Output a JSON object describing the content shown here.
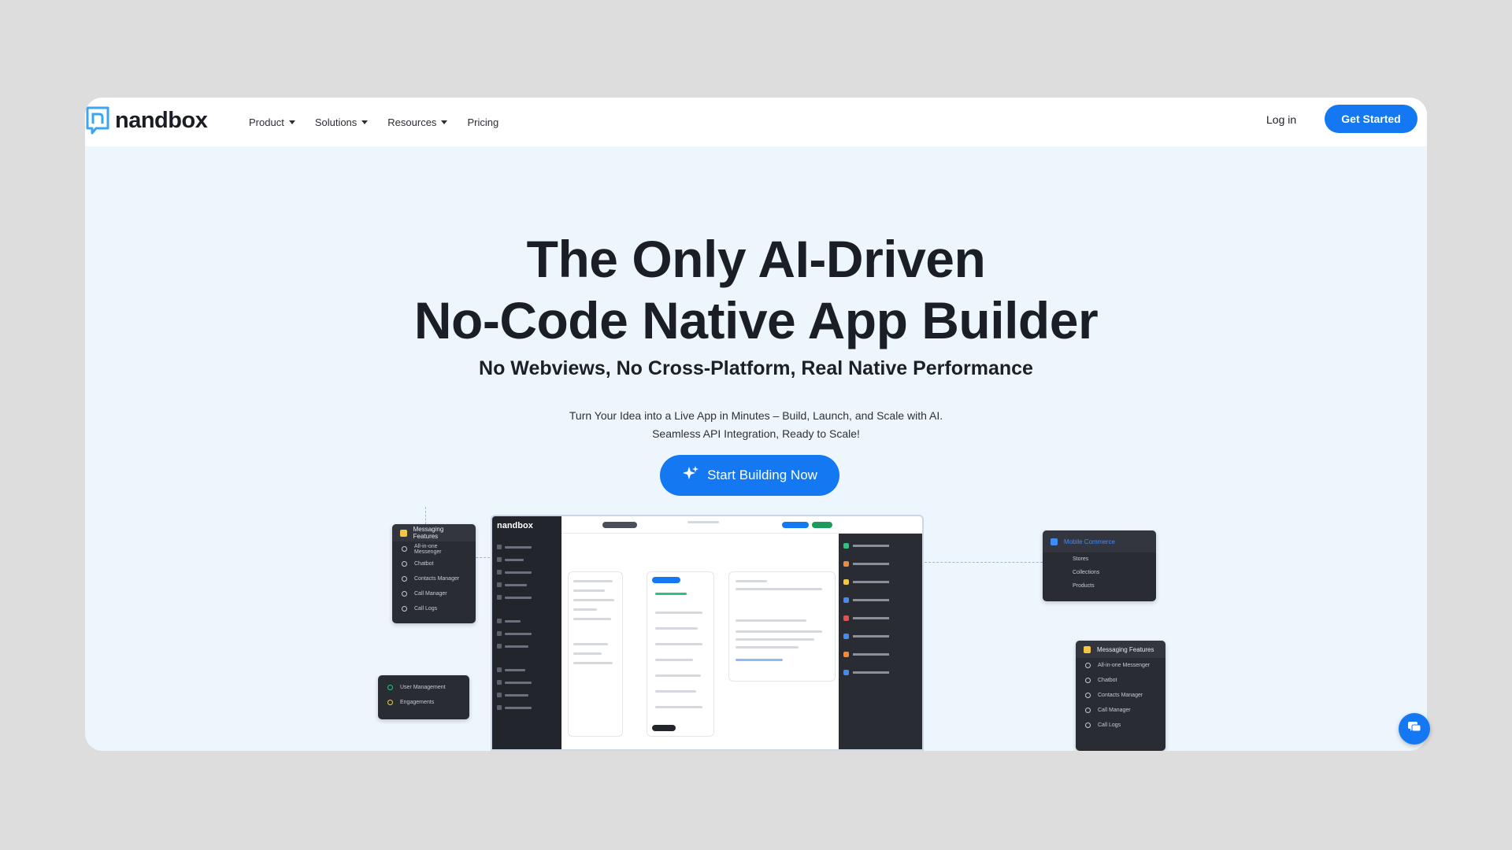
{
  "header": {
    "logo_text": "nandbox",
    "nav": [
      {
        "label": "Product",
        "has_dropdown": true
      },
      {
        "label": "Solutions",
        "has_dropdown": true
      },
      {
        "label": "Resources",
        "has_dropdown": true
      },
      {
        "label": "Pricing",
        "has_dropdown": false
      }
    ],
    "login_label": "Log in",
    "cta_label": "Get Started"
  },
  "hero": {
    "title_line1": "The Only AI-Driven",
    "title_line2": "No-Code Native App Builder",
    "subtitle": "No Webviews, No Cross-Platform, Real Native Performance",
    "description_line1": "Turn Your Idea into a Live App in Minutes – Build, Launch, and Scale with AI.",
    "description_line2": "Seamless API Integration, Ready to Scale!",
    "cta_label": "Start Building Now",
    "cta_icon": "sparkle-icon"
  },
  "mockup": {
    "brand": "nandbox",
    "left_top_panel": {
      "title": "Messaging Features",
      "items": [
        "All-in-one Messenger",
        "Chatbot",
        "Contacts Manager",
        "Call Manager",
        "Call Logs"
      ]
    },
    "left_bottom_panel": {
      "items": [
        "User Management",
        "Engagements"
      ]
    },
    "right_top_panel": {
      "title": "Mobile Commerce",
      "items": [
        "Stores",
        "Collections",
        "Products"
      ]
    },
    "right_bottom_panel": {
      "title": "Messaging Features",
      "items": [
        "All-in-one Messenger",
        "Chatbot",
        "Contacts Manager",
        "Call Manager",
        "Call Logs"
      ]
    }
  },
  "colors": {
    "accent": "#1478f2",
    "page_bg": "#eef6fd",
    "dark_panel": "#2a2c34"
  },
  "chat_widget_icon": "chat-icon"
}
